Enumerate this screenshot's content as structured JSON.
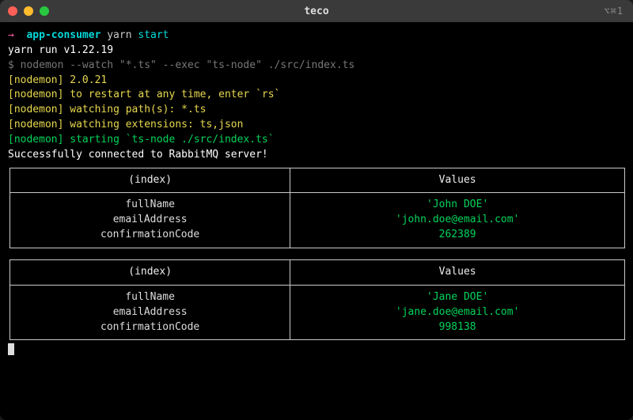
{
  "window": {
    "title": "teco",
    "shortcut": "⌥⌘1"
  },
  "prompt": {
    "arrow": "→",
    "dir": "app-consumer",
    "cmd1": "yarn",
    "cmd2": "start"
  },
  "lines": {
    "yarn_run": "yarn run v1.22.19",
    "nodemon_cmd_prefix": "$ ",
    "nodemon_cmd": "nodemon --watch \"*.ts\" --exec \"ts-node\" ./src/index.ts",
    "n1_tag": "[nodemon]",
    "n1_text": " 2.0.21",
    "n2_text": " to restart at any time, enter `rs`",
    "n3_text": " watching path(s): *.ts",
    "n4_text": " watching extensions: ts,json",
    "n5_text": " starting `ts-node ./src/index.ts`",
    "connected": "Successfully connected to RabbitMQ server!"
  },
  "table_headers": {
    "index": "(index)",
    "values": "Values"
  },
  "tables": [
    {
      "rows": [
        {
          "key": "fullName",
          "value": "'John DOE'"
        },
        {
          "key": "emailAddress",
          "value": "'john.doe@email.com'"
        },
        {
          "key": "confirmationCode",
          "value": "262389"
        }
      ]
    },
    {
      "rows": [
        {
          "key": "fullName",
          "value": "'Jane DOE'"
        },
        {
          "key": "emailAddress",
          "value": "'jane.doe@email.com'"
        },
        {
          "key": "confirmationCode",
          "value": "998138"
        }
      ]
    }
  ]
}
